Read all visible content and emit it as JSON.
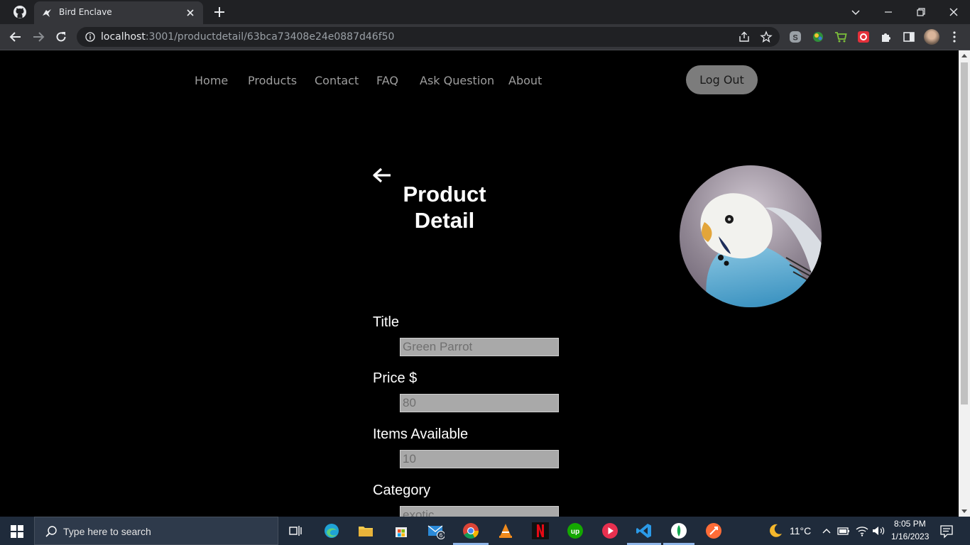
{
  "browser": {
    "tab_title": "Bird Enclave",
    "url_host": "localhost",
    "url_path": ":3001/productdetail/63bca73408e24e0887d46f50"
  },
  "nav": {
    "items": [
      "Home",
      "Products",
      "Contact",
      "FAQ",
      "Ask Question",
      "About"
    ],
    "logout_label": "Log Out"
  },
  "main": {
    "heading_line1": "Product",
    "heading_line2": "Detail",
    "fields": [
      {
        "label": "Title",
        "value": "Green Parrot"
      },
      {
        "label": "Price $",
        "value": "80"
      },
      {
        "label": "Items Available",
        "value": "10"
      },
      {
        "label": "Category",
        "value": "exotic"
      }
    ]
  },
  "taskbar": {
    "search_placeholder": "Type here to search",
    "mail_badge": "6",
    "weather": "11°C",
    "time": "8:05 PM",
    "date": "1/16/2023"
  },
  "colors": {
    "page_bg": "#000000",
    "nav_text": "#9e9e9e",
    "logout_bg": "#7c7c7c",
    "input_bg": "#a9a9a9",
    "bird_blue": "#57a9cf"
  }
}
